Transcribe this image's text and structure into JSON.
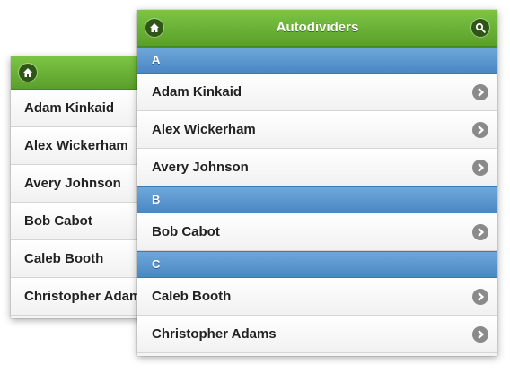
{
  "header": {
    "title": "Autodividers",
    "home_icon": "home-icon",
    "search_icon": "search-icon"
  },
  "back_list": {
    "items": [
      "Adam Kinkaid",
      "Alex Wickerham",
      "Avery Johnson",
      "Bob Cabot",
      "Caleb Booth",
      "Christopher Adams"
    ]
  },
  "front_list": {
    "sections": [
      {
        "letter": "A",
        "items": [
          "Adam Kinkaid",
          "Alex Wickerham",
          "Avery Johnson"
        ]
      },
      {
        "letter": "B",
        "items": [
          "Bob Cabot"
        ]
      },
      {
        "letter": "C",
        "items": [
          "Caleb Booth",
          "Christopher Adams"
        ]
      }
    ]
  },
  "colors": {
    "header_green": "#6cb33a",
    "divider_blue": "#5a95cf",
    "chevron_gray": "#8a8a8a"
  }
}
